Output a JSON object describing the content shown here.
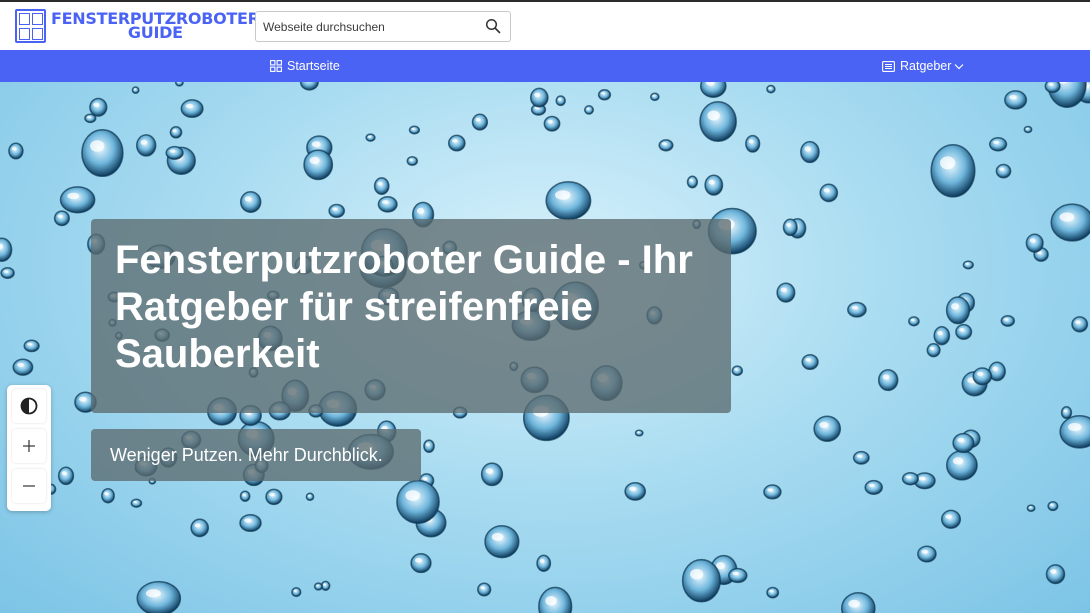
{
  "header": {
    "logo_line1": "FENSTERPUTZROBOTER",
    "logo_line2": "GUIDE",
    "brand_color": "#4a63f5"
  },
  "search": {
    "placeholder": "Webseite durchsuchen",
    "icon": "search-icon"
  },
  "nav": {
    "items": [
      {
        "label": "Startseite",
        "icon": "grid-icon"
      },
      {
        "label": "Ratgeber",
        "icon": "newspaper-icon",
        "dropdown": true
      }
    ]
  },
  "hero": {
    "title": "Fensterputzroboter Guide - Ihr Ratgeber für streifenfreie Sauberkeit",
    "subtitle": "Weniger Putzen. Mehr Durchblick."
  },
  "accessibility_tools": [
    {
      "icon": "contrast-icon"
    },
    {
      "icon": "zoom-in-icon"
    },
    {
      "icon": "zoom-out-icon"
    }
  ]
}
